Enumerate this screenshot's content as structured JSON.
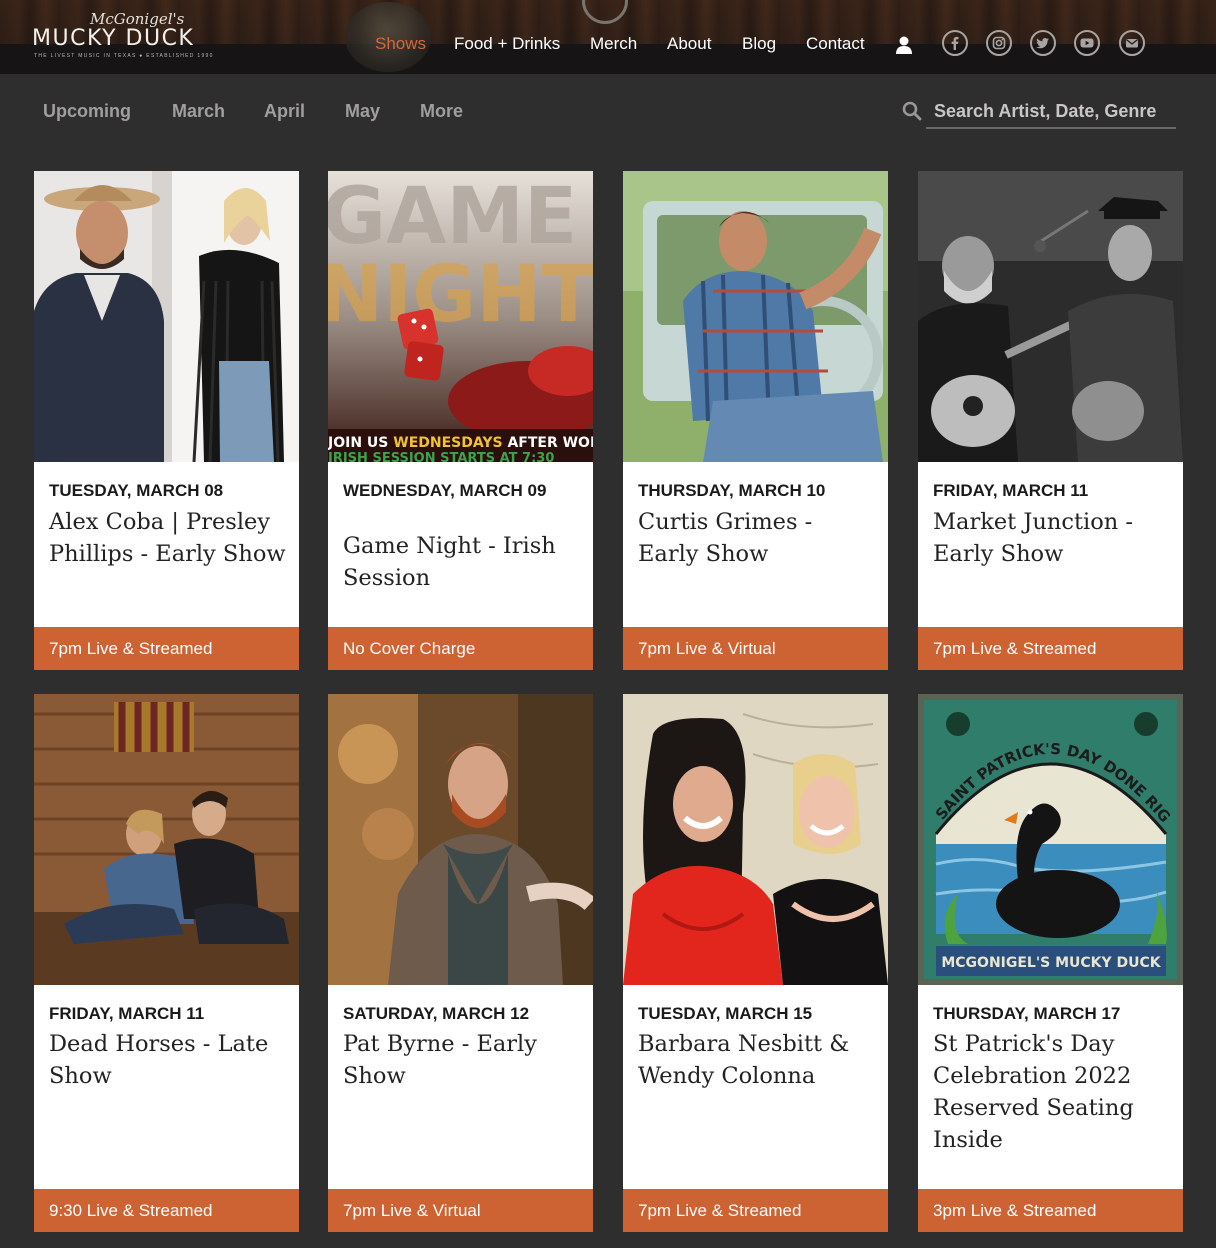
{
  "header": {
    "logo_script": "McGonigel's",
    "logo_main": "MUCKY DUCK",
    "logo_tagline": "THE LIVEST MUSIC IN TEXAS ● ESTABLISHED 1990",
    "nav": [
      "Shows",
      "Food + Drinks",
      "Merch",
      "About",
      "Blog",
      "Contact"
    ],
    "active_nav": "Shows",
    "icons": [
      "user-icon",
      "facebook-icon",
      "instagram-icon",
      "twitter-icon",
      "youtube-icon",
      "email-icon"
    ]
  },
  "subnav": {
    "items": [
      "Upcoming",
      "March",
      "April",
      "May",
      "More"
    ],
    "search_placeholder": "Search Artist, Date, Genre"
  },
  "colors": {
    "accent": "#cd6233",
    "active_nav": "#d4693a",
    "page_bg": "#2f2e2f"
  },
  "shows": [
    {
      "date": "TUESDAY, MARCH 08",
      "title": "Alex Coba | Presley Phillips - Early Show",
      "info": "7pm Live & Streamed",
      "image": "alex-coba-presley-phillips-photo"
    },
    {
      "date": "WEDNESDAY, MARCH 09",
      "title": "Game Night - Irish Session",
      "info": "No Cover Charge",
      "image": "game-night-poster",
      "poster_text": {
        "line1": "GAME",
        "line2": "NIGHT",
        "banner_a": "JOIN US ",
        "banner_b": "WEDNESDAYS",
        "banner_c": " AFTER WORK",
        "banner_d": "IRISH SESSION STARTS AT 7:30"
      }
    },
    {
      "date": "THURSDAY, MARCH 10",
      "title": "Curtis Grimes - Early Show",
      "info": "7pm Live & Virtual",
      "image": "curtis-grimes-photo"
    },
    {
      "date": "FRIDAY, MARCH 11",
      "title": "Market Junction - Early Show",
      "info": "7pm Live & Streamed",
      "image": "market-junction-photo"
    },
    {
      "date": "FRIDAY, MARCH 11",
      "title": "Dead Horses - Late Show",
      "info": "9:30 Live & Streamed",
      "image": "dead-horses-photo"
    },
    {
      "date": "SATURDAY, MARCH 12",
      "title": "Pat Byrne - Early Show",
      "info": "7pm Live & Virtual",
      "image": "pat-byrne-photo"
    },
    {
      "date": "TUESDAY, MARCH 15",
      "title": "Barbara Nesbitt & Wendy Colonna",
      "info": "7pm Live & Streamed",
      "image": "barbara-nesbitt-wendy-colonna-photo"
    },
    {
      "date": "THURSDAY, MARCH 17",
      "title": "St Patrick's Day Celebration 2022 Reserved Seating Inside",
      "info": "3pm Live & Streamed",
      "image": "st-patricks-day-poster",
      "poster_text": {
        "arch": "SAINT PATRICK'S DAY DONE RIGHT",
        "banner": "MCGONIGEL'S MUCKY DUCK"
      }
    }
  ]
}
